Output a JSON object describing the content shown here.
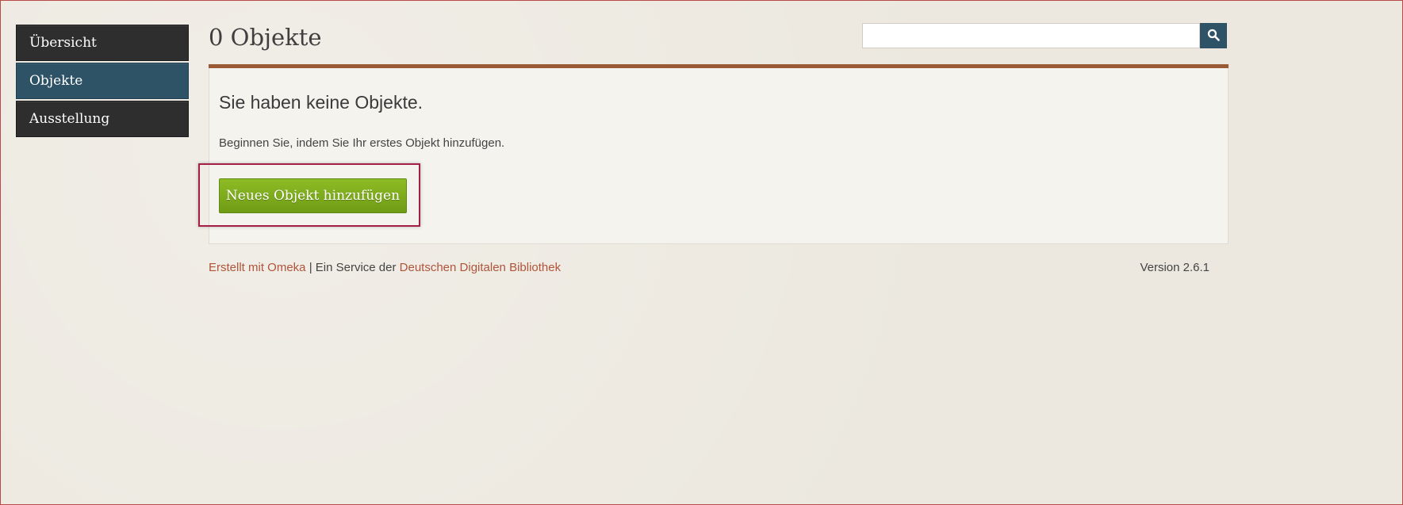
{
  "sidebar": {
    "items": [
      {
        "label": "Übersicht"
      },
      {
        "label": "Objekte"
      },
      {
        "label": "Ausstellung"
      }
    ]
  },
  "header": {
    "title": "0 Objekte",
    "search": {
      "value": "",
      "placeholder": ""
    },
    "search_icon": "search-icon"
  },
  "main": {
    "heading": "Sie haben keine Objekte.",
    "text": "Beginnen Sie, indem Sie Ihr erstes Objekt hinzufügen.",
    "add_button_label": "Neues Objekt hinzufügen"
  },
  "footer": {
    "link_omeka": "Erstellt mit Omeka",
    "separator": " | Ein Service der ",
    "link_ddb": "Deutschen Digitalen Bibliothek",
    "version": "Version 2.6.1"
  },
  "colors": {
    "nav_dark": "#2e2e2e",
    "nav_active": "#2f5366",
    "accent_rule": "#9b5a36",
    "button_green": "#7aa91b",
    "link": "#b0543a",
    "highlight": "#a31f45"
  }
}
